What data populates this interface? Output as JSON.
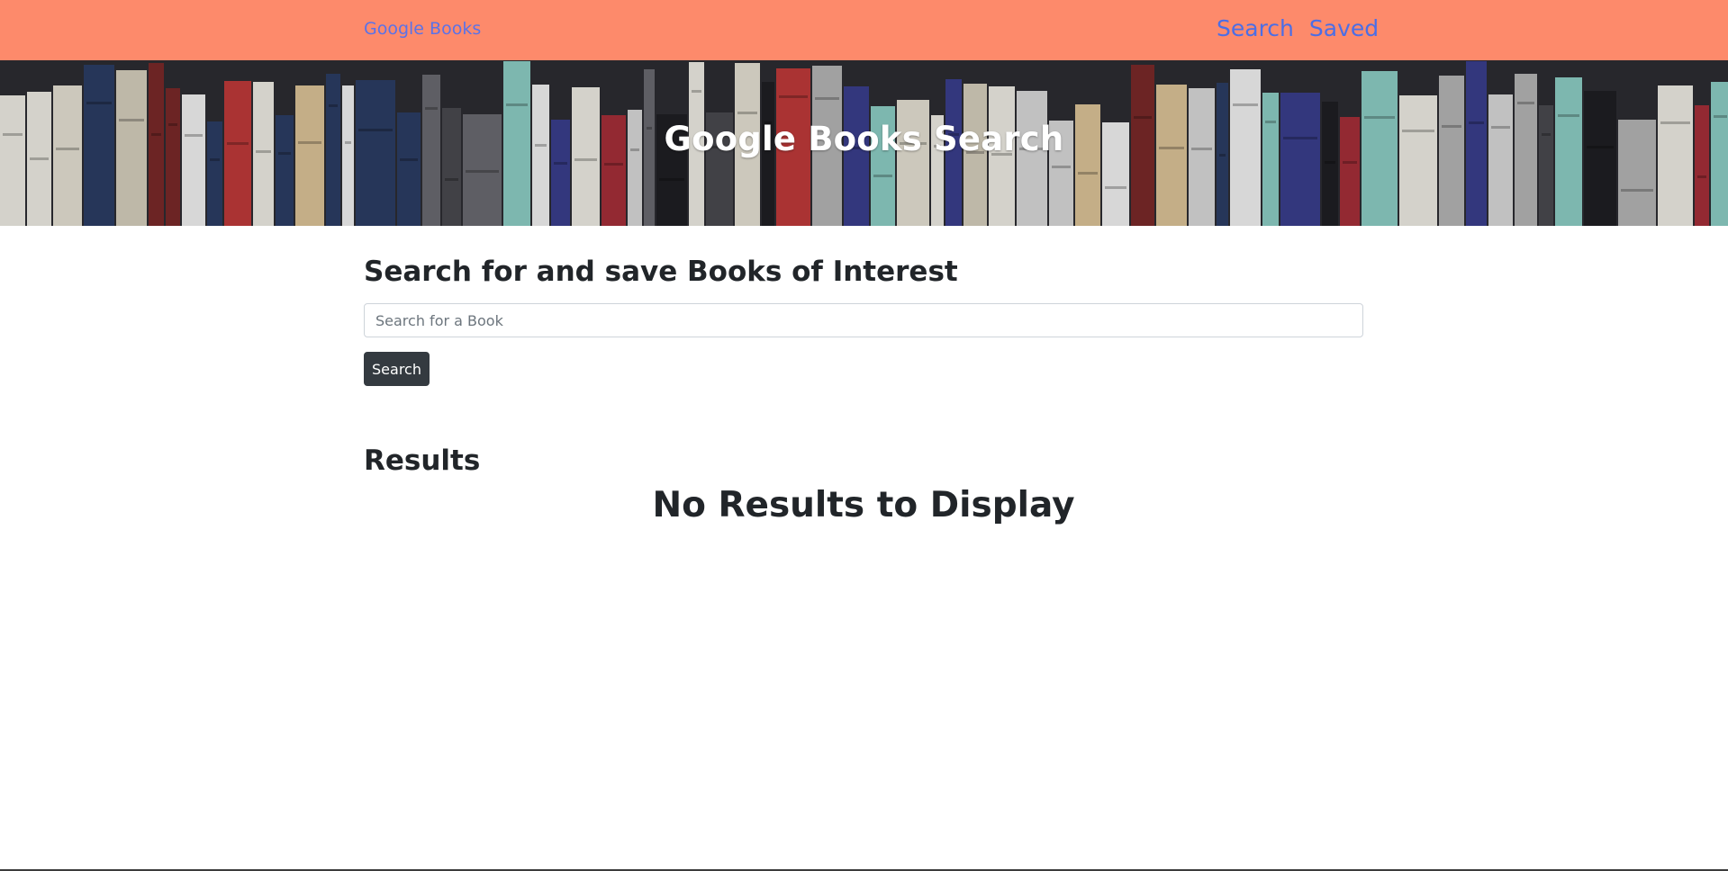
{
  "navbar": {
    "brand": "Google Books",
    "links": [
      "Search",
      "Saved"
    ],
    "background_color": "#fd8a6b",
    "link_color": "#4b6ee6"
  },
  "hero": {
    "title": "Google Books Search",
    "background": "bookshelf-photo"
  },
  "search": {
    "heading": "Search for and save Books of Interest",
    "placeholder": "Search for a Book",
    "value": "",
    "button_label": "Search",
    "button_color": "#343a40"
  },
  "results": {
    "heading": "Results",
    "empty_message": "No Results to Display"
  }
}
